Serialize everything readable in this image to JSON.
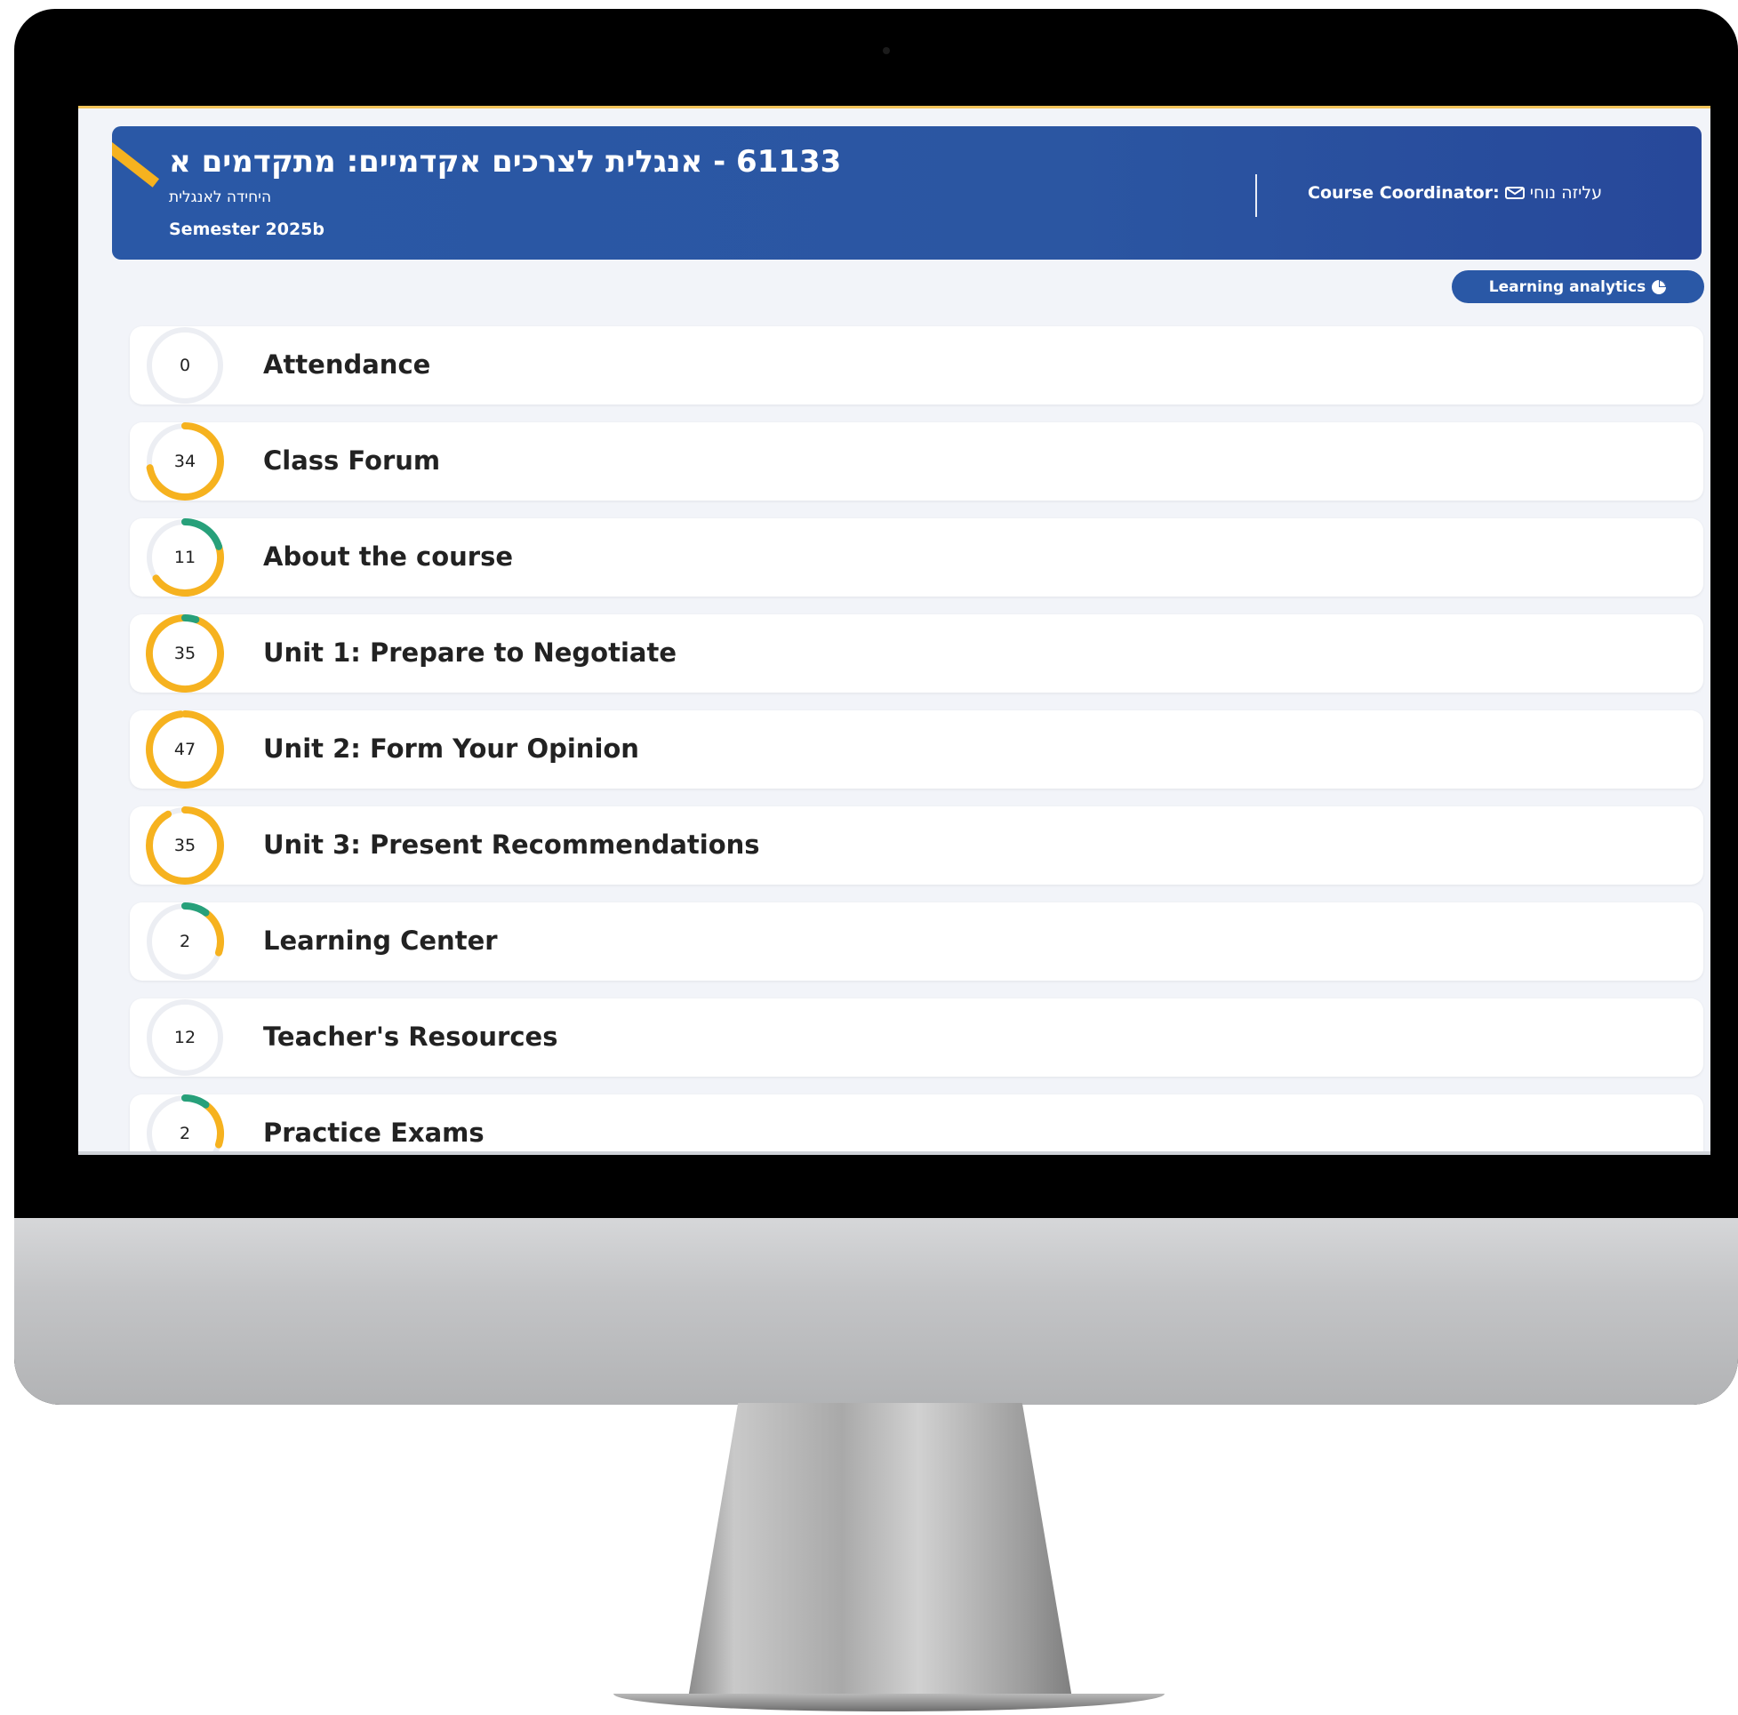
{
  "course": {
    "title": "61133 - אנגלית לצרכים אקדמיים: מתקדמים א",
    "unit": "היחידה לאנגלית",
    "semester": "Semester 2025b",
    "coordinator_label": "Course Coordinator:",
    "coordinator_name": "עליזה נוחי",
    "coordinator_icon": "mail-icon"
  },
  "analytics_button": {
    "label": "Learning analytics",
    "icon": "pie-chart-icon"
  },
  "colors": {
    "brand": "#2a58a6",
    "progress_done": "#f6b21f",
    "progress_new": "#27a07a",
    "ring_track": "#eceef3"
  },
  "sections": [
    {
      "label": "Attendance",
      "count": "0",
      "done": 0,
      "new": 0
    },
    {
      "label": "Class Forum",
      "count": "34",
      "done": 0.72,
      "new": 0
    },
    {
      "label": "About the course",
      "count": "11",
      "done": 0.45,
      "new": 0.2
    },
    {
      "label": "Unit 1: Prepare to Negotiate",
      "count": "35",
      "done": 0.94,
      "new": 0.05
    },
    {
      "label": "Unit 2: Form Your Opinion",
      "count": "47",
      "done": 0.98,
      "new": 0
    },
    {
      "label": "Unit 3: Present Recommendations",
      "count": "35",
      "done": 0.92,
      "new": 0
    },
    {
      "label": "Learning Center",
      "count": "2",
      "done": 0.2,
      "new": 0.1
    },
    {
      "label": "Teacher's Resources",
      "count": "12",
      "done": 0,
      "new": 0
    },
    {
      "label": "Practice Exams",
      "count": "2",
      "done": 0.2,
      "new": 0.1
    }
  ]
}
